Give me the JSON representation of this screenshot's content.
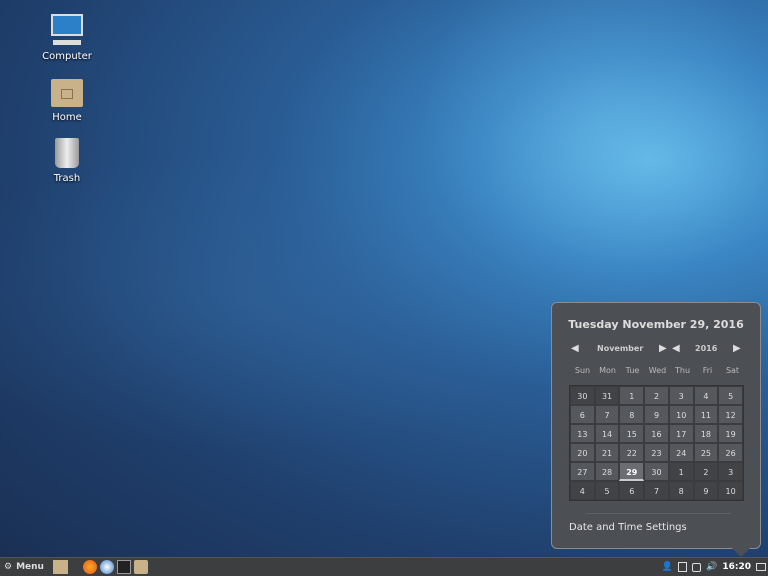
{
  "desktop": {
    "icons": [
      {
        "label": "Computer",
        "icon": "computer-icon"
      },
      {
        "label": "Home",
        "icon": "home-folder-icon"
      },
      {
        "label": "Trash",
        "icon": "trash-icon"
      }
    ]
  },
  "calendar": {
    "title": "Tuesday November 29, 2016",
    "month": "November",
    "year": "2016",
    "weekdays": [
      "Sun",
      "Mon",
      "Tue",
      "Wed",
      "Thu",
      "Fri",
      "Sat"
    ],
    "days": [
      [
        "30",
        "31",
        "1",
        "2",
        "3",
        "4",
        "5"
      ],
      [
        "6",
        "7",
        "8",
        "9",
        "10",
        "11",
        "12"
      ],
      [
        "13",
        "14",
        "15",
        "16",
        "17",
        "18",
        "19"
      ],
      [
        "20",
        "21",
        "22",
        "23",
        "24",
        "25",
        "26"
      ],
      [
        "27",
        "28",
        "29",
        "30",
        "1",
        "2",
        "3"
      ],
      [
        "4",
        "5",
        "6",
        "7",
        "8",
        "9",
        "10"
      ]
    ],
    "settings_label": "Date and Time Settings"
  },
  "taskbar": {
    "menu_label": "Menu",
    "clock": "16:20"
  }
}
